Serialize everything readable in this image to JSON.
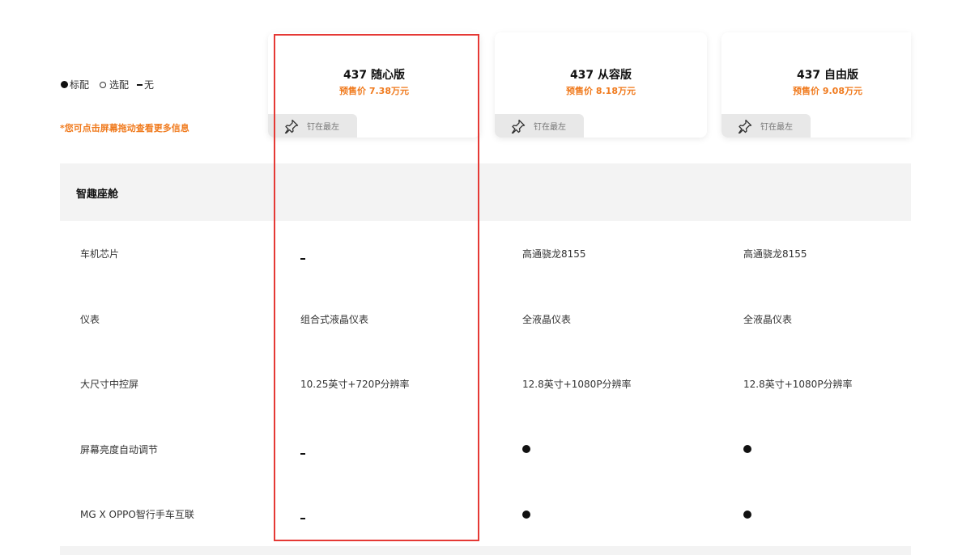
{
  "legend": {
    "standard": "标配",
    "optional": "选配",
    "none": "无"
  },
  "hint": "*您可点击屏幕拖动查看更多信息",
  "models": [
    {
      "name": "437 随心版",
      "price": "预售价 7.38万元",
      "pin_label": "钉在最左"
    },
    {
      "name": "437 从容版",
      "price": "预售价 8.18万元",
      "pin_label": "钉在最左"
    },
    {
      "name": "437 自由版",
      "price": "预售价 9.08万元",
      "pin_label": "钉在最左"
    }
  ],
  "section": {
    "title": "智趣座舱"
  },
  "rows": [
    {
      "label": "车机芯片",
      "values": [
        {
          "type": "dash"
        },
        {
          "type": "text",
          "text": "高通骁龙8155"
        },
        {
          "type": "text",
          "text": "高通骁龙8155"
        }
      ]
    },
    {
      "label": "仪表",
      "values": [
        {
          "type": "text",
          "text": "组合式液晶仪表"
        },
        {
          "type": "text",
          "text": "全液晶仪表"
        },
        {
          "type": "text",
          "text": "全液晶仪表"
        }
      ]
    },
    {
      "label": "大尺寸中控屏",
      "values": [
        {
          "type": "text",
          "text": "10.25英寸+720P分辨率"
        },
        {
          "type": "text",
          "text": "12.8英寸+1080P分辨率"
        },
        {
          "type": "text",
          "text": "12.8英寸+1080P分辨率"
        }
      ]
    },
    {
      "label": "屏幕亮度自动调节",
      "values": [
        {
          "type": "dash"
        },
        {
          "type": "dot"
        },
        {
          "type": "dot"
        }
      ]
    },
    {
      "label": "MG X OPPO智行手车互联",
      "values": [
        {
          "type": "dash"
        },
        {
          "type": "dot"
        },
        {
          "type": "dot"
        }
      ]
    }
  ],
  "colors": {
    "accent": "#f07a1d",
    "highlight": "#e53935",
    "section_bg": "#f3f3f3"
  }
}
